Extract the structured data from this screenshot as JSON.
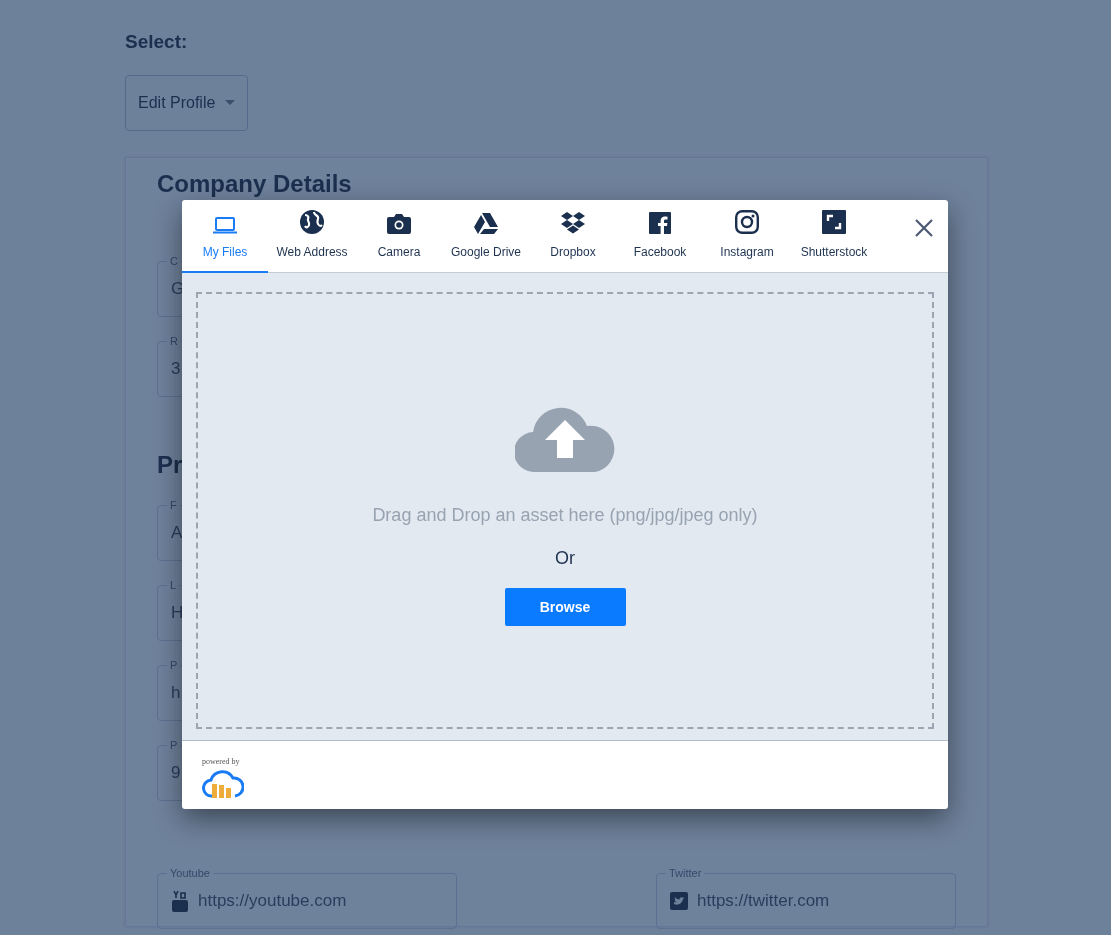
{
  "page": {
    "select_label": "Select:",
    "dropdown": {
      "value": "Edit Profile"
    }
  },
  "form": {
    "heading_1": "Company Details",
    "heading_2": "Pr",
    "fields": [
      {
        "label": "C",
        "value": "G"
      },
      {
        "label": "R",
        "value": "3"
      },
      {
        "label": "F",
        "value": "A"
      },
      {
        "label": "L",
        "value": "H"
      },
      {
        "label": "P",
        "value": "h"
      },
      {
        "label": "P",
        "value": "9"
      }
    ],
    "social": [
      {
        "label": "Youtube",
        "value": "https://youtube.com"
      },
      {
        "label": "Twitter",
        "value": "https://twitter.com"
      }
    ]
  },
  "modal": {
    "tabs": [
      {
        "label": "My Files",
        "selected": true
      },
      {
        "label": "Web Address",
        "selected": false
      },
      {
        "label": "Camera",
        "selected": false
      },
      {
        "label": "Google Drive",
        "selected": false
      },
      {
        "label": "Dropbox",
        "selected": false
      },
      {
        "label": "Facebook",
        "selected": false
      },
      {
        "label": "Instagram",
        "selected": false
      },
      {
        "label": "Shutterstock",
        "selected": false
      }
    ],
    "drop_text": "Drag and Drop an asset here (png/jpg/jpeg only)",
    "or_text": "Or",
    "browse_button": "Browse",
    "powered_by": "powered by"
  }
}
